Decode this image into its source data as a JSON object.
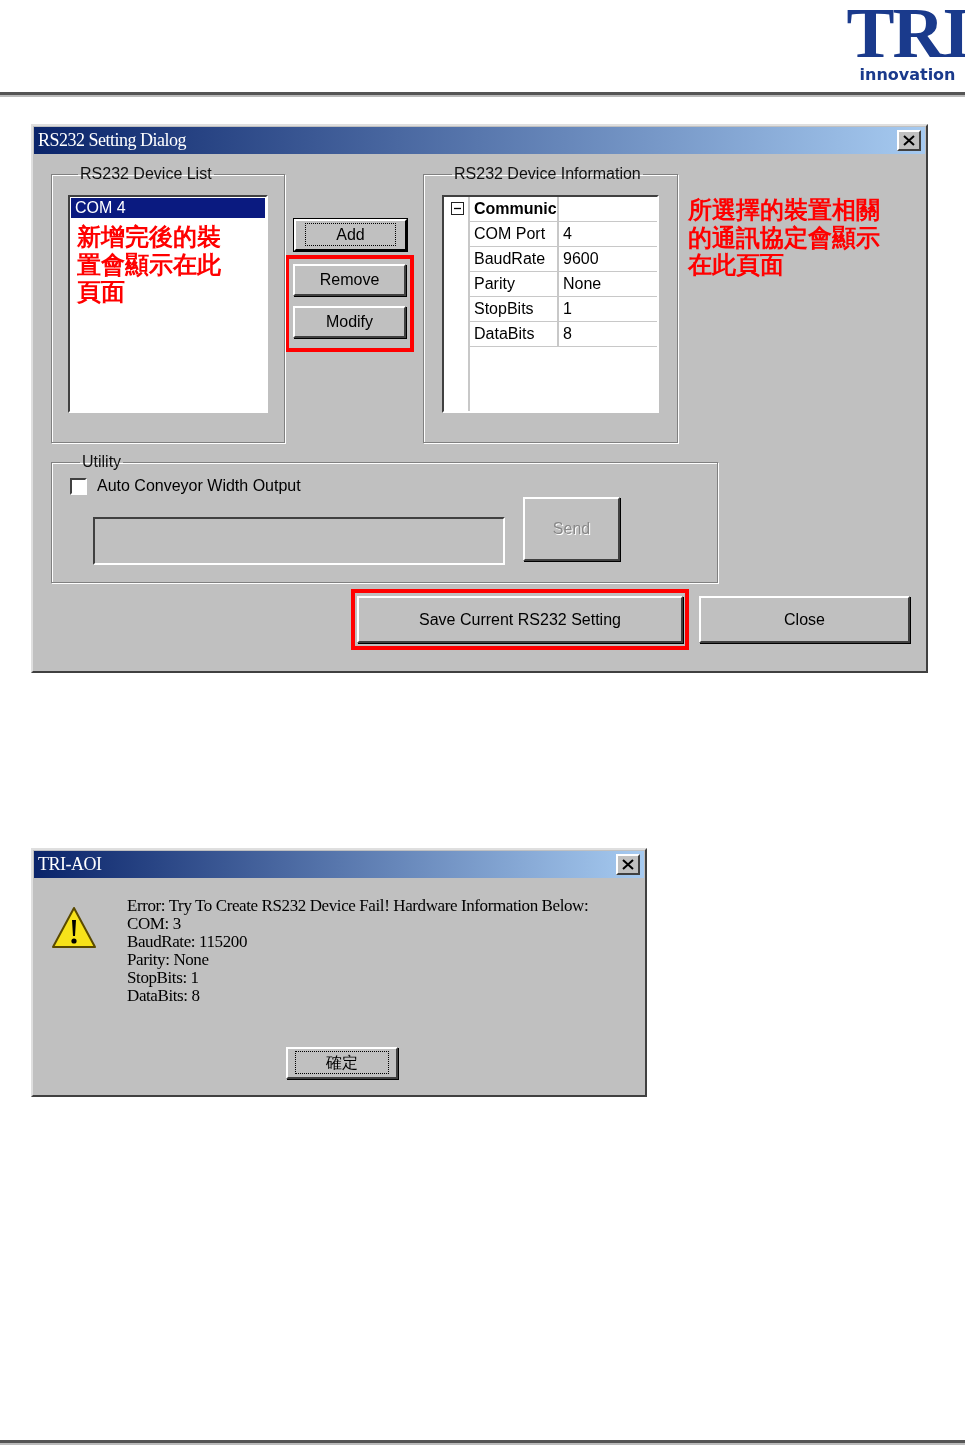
{
  "header": {
    "logo_text": "TRI",
    "logo_subtext": "innovation"
  },
  "settings_dialog": {
    "title": "RS232 Setting Dialog",
    "device_list": {
      "label": "RS232 Device List",
      "items": [
        {
          "text": "COM 4",
          "selected": true
        }
      ],
      "note": "新增完後的裝置會顯示在此頁面"
    },
    "list_buttons": [
      {
        "label": "Add",
        "focused": true,
        "highlighted": false
      },
      {
        "label": "Remove",
        "focused": false,
        "highlighted": true
      },
      {
        "label": "Modify",
        "focused": false,
        "highlighted": true
      }
    ],
    "device_info": {
      "label": "RS232 Device Information",
      "group": {
        "name": "Communic",
        "expanded": true
      },
      "rows": [
        {
          "name": "COM Port",
          "value": "4"
        },
        {
          "name": "BaudRate",
          "value": "9600"
        },
        {
          "name": "Parity",
          "value": "None"
        },
        {
          "name": "StopBits",
          "value": "1"
        },
        {
          "name": "DataBits",
          "value": "8"
        }
      ]
    },
    "info_note": "所選擇的裝置相關的通訊協定會顯示在此頁面",
    "utility": {
      "label": "Utility",
      "checkbox": {
        "label": "Auto Conveyor Width Output",
        "checked": false
      },
      "send_button": {
        "label": "Send",
        "disabled": true
      }
    },
    "save_button": {
      "label": "Save Current RS232 Setting",
      "highlighted": true
    },
    "close_button": {
      "label": "Close"
    }
  },
  "message_box": {
    "title": "TRI-AOI",
    "lines": [
      "Error: Try To Create RS232 Device Fail! Hardware Information Below:",
      "COM: 3",
      "BaudRate: 115200",
      "Parity: None",
      "StopBits: 1",
      "DataBits: 8"
    ],
    "ok_button": "確定"
  }
}
